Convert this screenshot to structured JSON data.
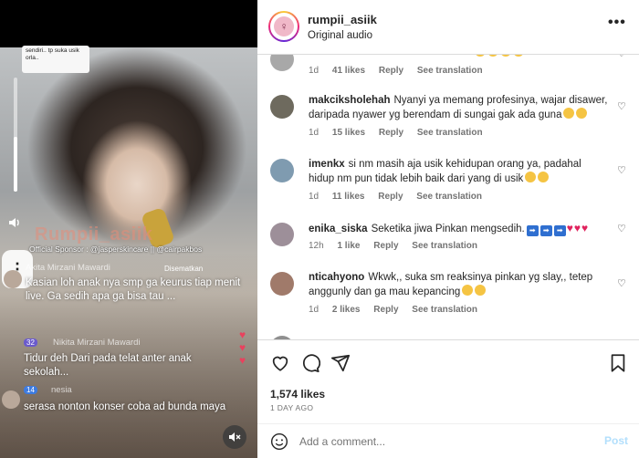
{
  "video": {
    "caption_box_text": "sendiri.. tp suka usik orla..",
    "watermark": "Rumpii_asiik",
    "sponsor": "Official Sponsor : @jasperskincare || @cairpakbos",
    "pinned": "Disematkan",
    "chat": [
      {
        "name": "Akita Mirzani Mawardi",
        "msg": "Kasian loh anak nya smp ga keurus tiap menit live. Ga sedih apa ga bisa tau ..."
      },
      {
        "name": "Nikita Mirzani Mawardi",
        "badge": "32",
        "msg": "Tidur deh Dari pada telat anter anak sekolah..."
      },
      {
        "name": "nesia",
        "badge": "14",
        "msg": "serasa nonton konser coba ad bunda maya"
      }
    ]
  },
  "header": {
    "username": "rumpii_asiik",
    "subtitle": "Original audio",
    "more_icon": "more-horizontal-icon"
  },
  "comments": [
    {
      "user": "",
      "text": "",
      "time": "1d",
      "likes": "41 likes",
      "reply": "Reply",
      "translate": "See translation",
      "avatar_color": "#a8a8a8",
      "emoji": 4
    },
    {
      "user": "makciksholehah",
      "text": "Nyanyi ya memang profesinya, wajar disawer, daripada nyawer yg berendam di sungai gak ada guna",
      "time": "1d",
      "likes": "15 likes",
      "reply": "Reply",
      "translate": "See translation",
      "avatar_color": "#6e6a5e",
      "emoji": 2
    },
    {
      "user": "imenkx",
      "text": "si nm masih aja usik kehidupan orang ya, padahal hidup nm pun tidak lebih baik dari yang di usik",
      "time": "1d",
      "likes": "11 likes",
      "reply": "Reply",
      "translate": "See translation",
      "avatar_color": "#7f9bb0",
      "emoji": 2
    },
    {
      "user": "enika_siska",
      "text": "Seketika jiwa Pinkan mengsedih.",
      "time": "12h",
      "likes": "1 like",
      "reply": "Reply",
      "translate": "See translation",
      "avatar_color": "#9d8f99",
      "squares": 3,
      "hearts": 3
    },
    {
      "user": "nticahyono",
      "text": "Wkwk,, suka sm reaksinya pinkan yg slay,, tetep anggunly dan ga mau kepancing",
      "time": "1d",
      "likes": "2 likes",
      "reply": "Reply",
      "translate": "See translation",
      "avatar_color": "#a07a6a",
      "emoji": 2
    }
  ],
  "actions": {
    "icons": [
      "heart-icon",
      "comment-icon",
      "share-icon",
      "bookmark-icon"
    ],
    "likes": "1,574 likes",
    "date": "1 DAY AGO",
    "comment_placeholder": "Add a comment...",
    "post_label": "Post"
  },
  "colors": {
    "accent_blue": "#0095f6",
    "post_disabled": "#b2dffc",
    "muted_text": "#737373"
  }
}
